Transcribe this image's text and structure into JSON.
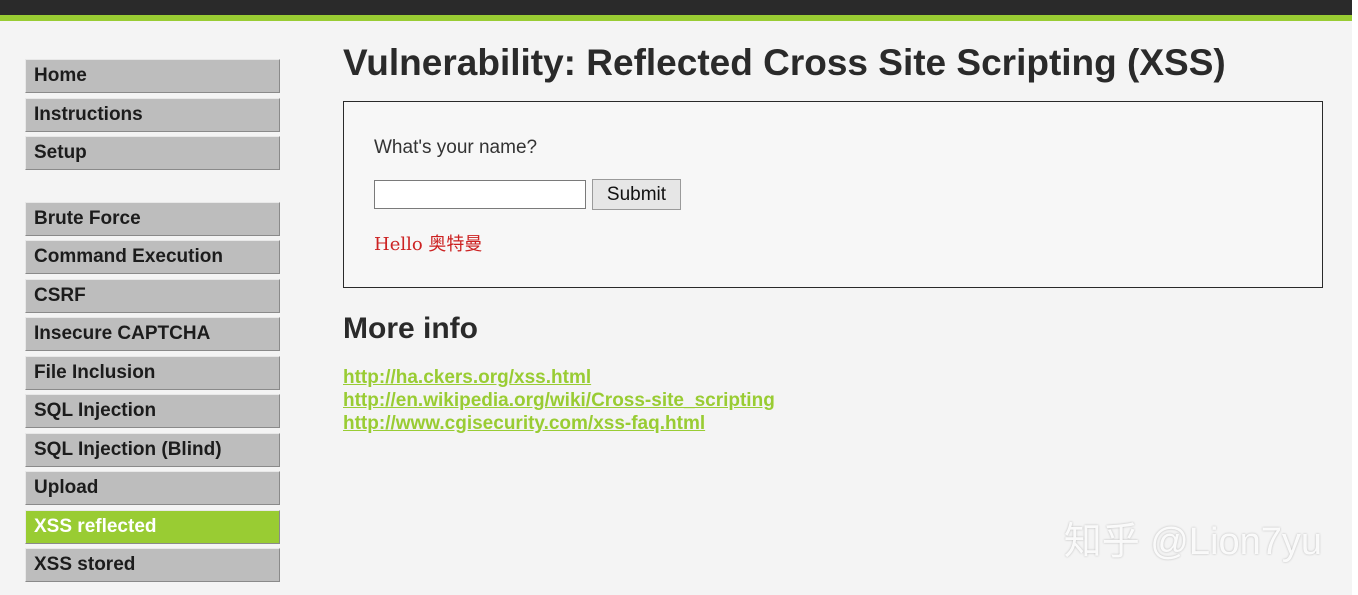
{
  "menu": {
    "group1": [
      "Home",
      "Instructions",
      "Setup"
    ],
    "group2": [
      "Brute Force",
      "Command Execution",
      "CSRF",
      "Insecure CAPTCHA",
      "File Inclusion",
      "SQL Injection",
      "SQL Injection (Blind)",
      "Upload",
      "XSS reflected",
      "XSS stored"
    ],
    "active": "XSS reflected"
  },
  "page": {
    "title": "Vulnerability: Reflected Cross Site Scripting (XSS)",
    "question": "What's your name?",
    "input_value": "",
    "submit_label": "Submit",
    "greeting": "Hello 奥特曼"
  },
  "more_info": {
    "title": "More info",
    "links": [
      "http://ha.ckers.org/xss.html",
      "http://en.wikipedia.org/wiki/Cross-site_scripting",
      "http://www.cgisecurity.com/xss-faq.html"
    ]
  },
  "watermark": "知乎 @Lion7yu",
  "colors": {
    "accent": "#99cc33",
    "header": "#2a2a2a",
    "menu_bg": "#bdbdbd",
    "greeting": "#cc2222"
  }
}
